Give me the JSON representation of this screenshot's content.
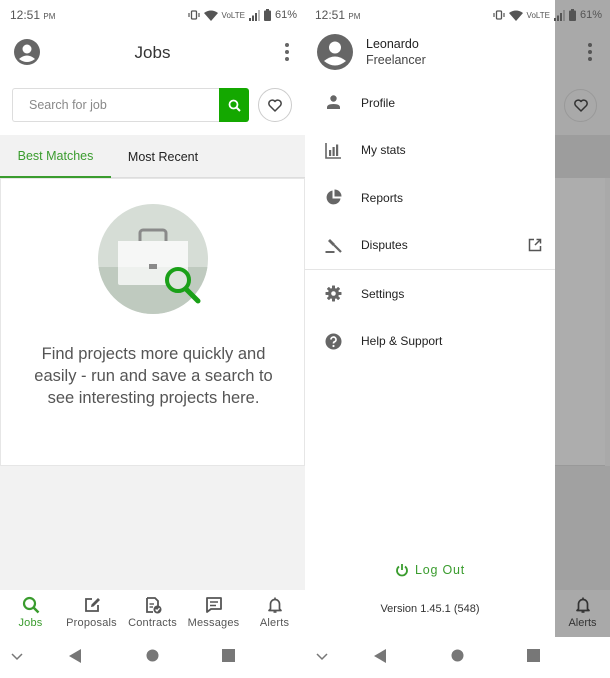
{
  "left_screen": {
    "status_bar": {
      "time": "12:51",
      "ampm": "PM",
      "network_label": "VoLTE",
      "battery": "61%"
    },
    "app_bar": {
      "title": "Jobs",
      "avatar_icon": "account-circle-icon",
      "menu_icon": "more-vert-icon"
    },
    "search": {
      "placeholder": "Search for job",
      "value": "",
      "button_icon": "search-icon",
      "favorite_icon": "heart-outline-icon"
    },
    "tabs": [
      {
        "label": "Best Matches",
        "active": true
      },
      {
        "label": "Most Recent",
        "active": false
      }
    ],
    "empty_state": {
      "illustration": "briefcase-search-illustration",
      "message": "Find projects more quickly and easily - run and save a search to see interesting projects here."
    },
    "bottom_nav": [
      {
        "label": "Jobs",
        "icon": "search-icon",
        "active": true
      },
      {
        "label": "Proposals",
        "icon": "edit-note-icon",
        "active": false
      },
      {
        "label": "Contracts",
        "icon": "contract-check-icon",
        "active": false
      },
      {
        "label": "Messages",
        "icon": "message-icon",
        "active": false
      },
      {
        "label": "Alerts",
        "icon": "bell-icon",
        "active": false
      }
    ]
  },
  "right_screen": {
    "status_bar": {
      "time": "12:51",
      "ampm": "PM",
      "network_label": "VoLTE",
      "battery": "61%"
    },
    "drawer": {
      "user": {
        "name": "Leonardo",
        "role": "Freelancer"
      },
      "menu_items": [
        {
          "label": "Profile",
          "icon": "person-icon",
          "external": false
        },
        {
          "label": "My stats",
          "icon": "bar-chart-icon",
          "external": false
        },
        {
          "label": "Reports",
          "icon": "pie-chart-icon",
          "external": false
        },
        {
          "label": "Disputes",
          "icon": "gavel-icon",
          "external": true
        },
        {
          "label": "Settings",
          "icon": "gear-icon",
          "external": false
        },
        {
          "label": "Help & Support",
          "icon": "help-circle-icon",
          "external": false
        }
      ],
      "logout_label": "Log Out",
      "version": "Version 1.45.1 (548)"
    },
    "background": {
      "empty_message": "Find projects more quickly and easily - run and save a search to see interesting projects here.",
      "alerts_label": "Alerts"
    }
  },
  "colors": {
    "accent_green": "#14a800",
    "active_tab_green": "#3a9c2e",
    "overlay_gray": "#a9a9a9"
  }
}
